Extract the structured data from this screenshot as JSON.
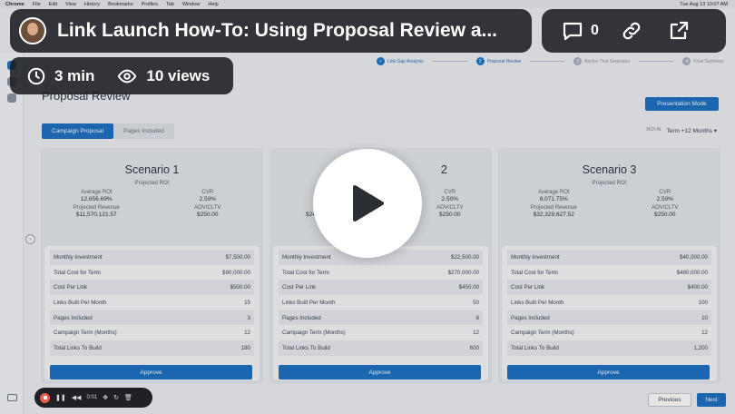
{
  "menubar": {
    "items": [
      "Chrome",
      "File",
      "Edit",
      "View",
      "History",
      "Bookmarks",
      "Profiles",
      "Tab",
      "Window",
      "Help"
    ],
    "clock": "Tue Aug 13 10:07 AM"
  },
  "stepper": {
    "steps": [
      {
        "num": "",
        "label": "Link Gap Analysis",
        "state": "done"
      },
      {
        "num": "2",
        "label": "Proposal Review",
        "state": "active"
      },
      {
        "num": "3",
        "label": "Anchor Text Generator",
        "state": "inactive"
      },
      {
        "num": "4",
        "label": "Final Summary",
        "state": "inactive"
      }
    ]
  },
  "page": {
    "title": "Proposal Review",
    "presentation_button": "Presentation Mode",
    "tabs": [
      "Campaign Proposal",
      "Pages Included"
    ],
    "roi_label": "ROI At",
    "roi_value": "Term +12 Months ▾"
  },
  "labels": {
    "projected_roi": "Projected ROI",
    "average_roi": "Average ROI",
    "cvr": "CVR",
    "projected_revenue": "Projected Revenue",
    "aov": "AOV/CLTV",
    "monthly_investment": "Monthly Investment",
    "total_cost": "Total Cost for Term",
    "cost_per_link": "Cost Per Link",
    "links_per_month": "Links Built Per Month",
    "pages_included": "Pages Included",
    "campaign_term": "Campaign Term (Months)",
    "total_links": "Total Links To Build",
    "approve": "Approve"
  },
  "scenarios": [
    {
      "title": "Scenario 1",
      "average_roi": "12,656.69%",
      "cvr": "2.50%",
      "projected_revenue": "$11,570,121.57",
      "aov": "$250.00",
      "monthly_investment": "$7,500.00",
      "total_cost": "$90,000.00",
      "cost_per_link": "$500.00",
      "links_per_month": "15",
      "pages_included": "3",
      "campaign_term": "12",
      "total_links": "180"
    },
    {
      "title": "2",
      "average_roi": "",
      "cvr": "2.50%",
      "projected_revenue": "$24",
      "aov": "$250.00",
      "monthly_investment": "$22,500.00",
      "total_cost": "$270,000.00",
      "cost_per_link": "$450.00",
      "links_per_month": "50",
      "pages_included": "8",
      "campaign_term": "12",
      "total_links": "600"
    },
    {
      "title": "Scenario 3",
      "average_roi": "8,071.75%",
      "cvr": "2.50%",
      "projected_revenue": "$32,329,627.52",
      "aov": "$250.00",
      "monthly_investment": "$40,000.00",
      "total_cost": "$480,000.00",
      "cost_per_link": "$400.00",
      "links_per_month": "100",
      "pages_included": "10",
      "campaign_term": "12",
      "total_links": "1,200"
    }
  ],
  "footer": {
    "previous": "Previous",
    "next": "Next"
  },
  "loom": {
    "title": "Link Launch How-To: Using Proposal Review a...",
    "comments": "0",
    "duration": "3 min",
    "views": "10 views",
    "rec_time": "0:01"
  },
  "colors": {
    "accent": "#1a6fc0",
    "record": "#e55b4d"
  }
}
